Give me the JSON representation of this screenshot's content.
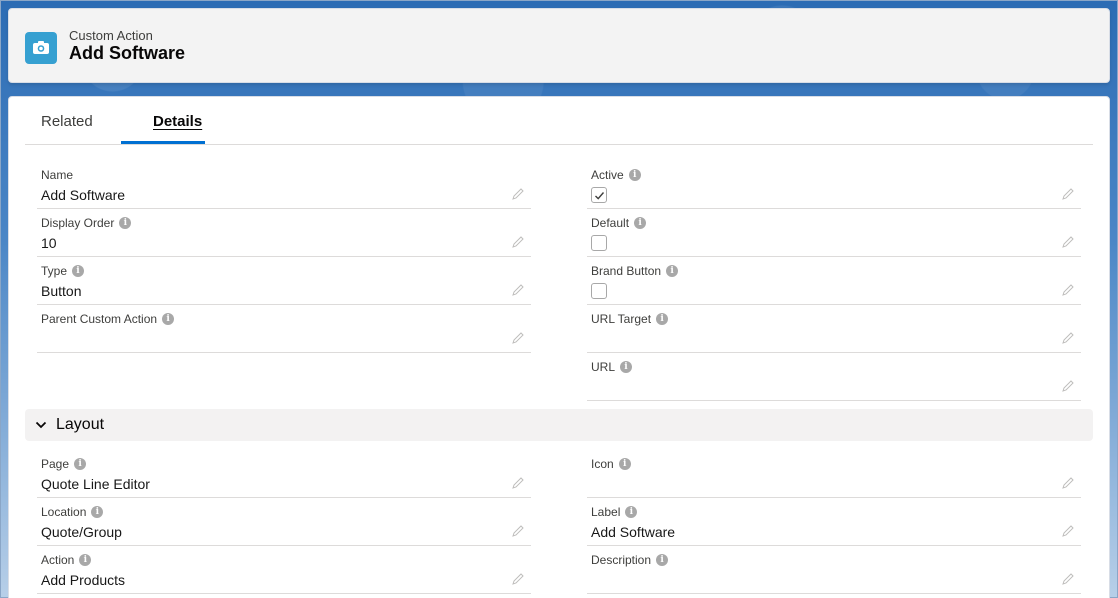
{
  "header": {
    "caption": "Custom Action",
    "title": "Add Software",
    "icon": "camera-icon"
  },
  "tabs": [
    {
      "label": "Related",
      "active": false
    },
    {
      "label": "Details",
      "active": true
    }
  ],
  "fields": {
    "name": {
      "label": "Name",
      "value": "Add Software"
    },
    "display_order": {
      "label": "Display Order",
      "value": "10"
    },
    "type": {
      "label": "Type",
      "value": "Button"
    },
    "parent_custom_action": {
      "label": "Parent Custom Action",
      "value": ""
    },
    "active": {
      "label": "Active",
      "checked": true
    },
    "default": {
      "label": "Default",
      "checked": false
    },
    "brand_button": {
      "label": "Brand Button",
      "checked": false
    },
    "url_target": {
      "label": "URL Target",
      "value": ""
    },
    "url": {
      "label": "URL",
      "value": ""
    }
  },
  "layout_section": {
    "title": "Layout",
    "fields": {
      "page": {
        "label": "Page",
        "value": "Quote Line Editor"
      },
      "location": {
        "label": "Location",
        "value": "Quote/Group"
      },
      "action": {
        "label": "Action",
        "value": "Add Products"
      },
      "icon": {
        "label": "Icon",
        "value": ""
      },
      "label": {
        "label": "Label",
        "value": "Add Software"
      },
      "description": {
        "label": "Description",
        "value": ""
      }
    }
  },
  "info_glyph": "i",
  "colors": {
    "accent": "#0070d2",
    "icon_bg": "#36a0d1",
    "section_bg": "#f3f2f2"
  }
}
